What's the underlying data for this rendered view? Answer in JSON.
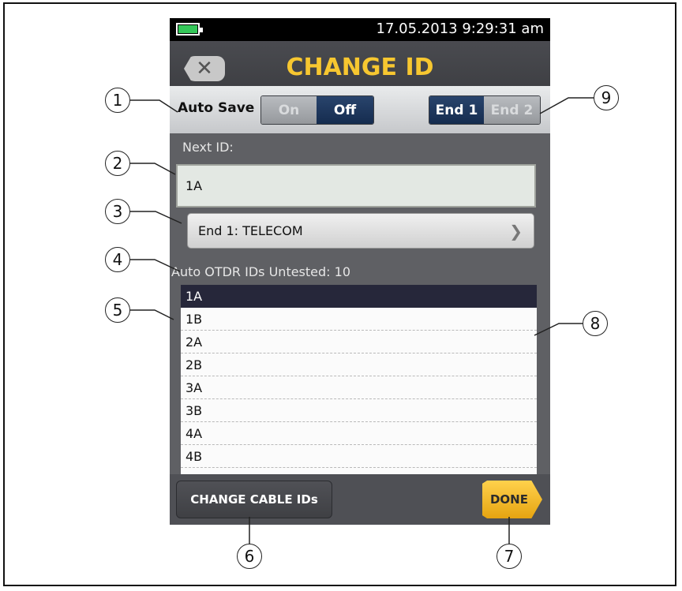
{
  "status": {
    "datetime": "17.05.2013 9:29:31 am"
  },
  "header": {
    "title": "CHANGE ID",
    "back_icon": "close-icon"
  },
  "autosave": {
    "label": "Auto Save",
    "on": "On",
    "off": "Off",
    "selected": "Off"
  },
  "end_toggle": {
    "end1": "End 1",
    "end2": "End 2",
    "selected": "End 1"
  },
  "next_id": {
    "label": "Next ID:",
    "value": "1A"
  },
  "end_selector": {
    "label": "End 1: TELECOM"
  },
  "untested": {
    "label": "Auto OTDR IDs Untested: 10"
  },
  "id_list": [
    "1A",
    "1B",
    "2A",
    "2B",
    "3A",
    "3B",
    "4A",
    "4B"
  ],
  "buttons": {
    "change_cable": "CHANGE CABLE IDs",
    "done": "DONE"
  },
  "callouts": [
    "1",
    "2",
    "3",
    "4",
    "5",
    "6",
    "7",
    "8",
    "9"
  ],
  "colors": {
    "title": "#f7c730",
    "selected_row": "#26273a",
    "done": "#f2b51f"
  }
}
